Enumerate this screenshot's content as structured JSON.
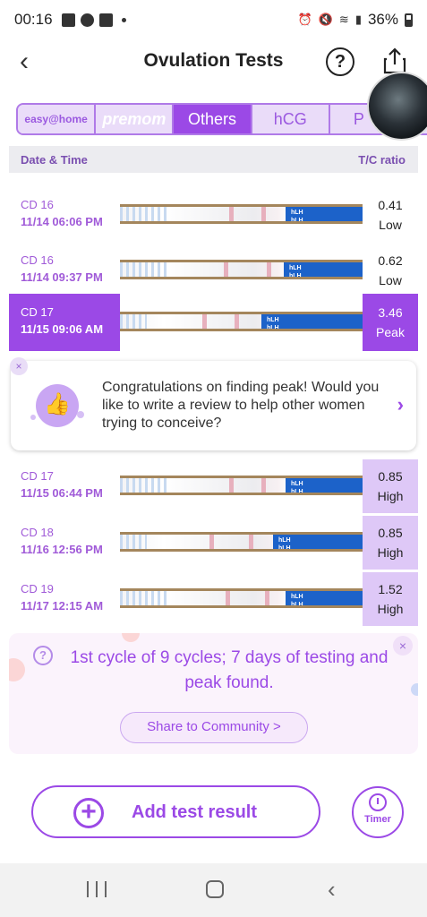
{
  "status_bar": {
    "time": "00:16",
    "battery": "36%"
  },
  "header": {
    "title": "Ovulation Tests",
    "help_symbol": "?",
    "back_symbol": "‹"
  },
  "brand_tabs": [
    {
      "label": "easy@home",
      "selected": false
    },
    {
      "label": "premom",
      "selected": false
    },
    {
      "label": "Others",
      "selected": true
    },
    {
      "label": "hCG",
      "selected": false
    },
    {
      "label": "P",
      "selected": false
    }
  ],
  "columns": {
    "date": "Date & Time",
    "ratio": "T/C ratio"
  },
  "tests": [
    {
      "cd": "CD 16",
      "datetime": "11/14  06:06 PM",
      "ratio": "0.41",
      "level": "Low"
    },
    {
      "cd": "CD 16",
      "datetime": "11/14  09:37 PM",
      "ratio": "0.62",
      "level": "Low"
    },
    {
      "cd": "CD 17",
      "datetime": "11/15  09:06 AM",
      "ratio": "3.46",
      "level": "Peak"
    },
    {
      "cd": "CD 17",
      "datetime": "11/15  06:44 PM",
      "ratio": "0.85",
      "level": "High"
    },
    {
      "cd": "CD 18",
      "datetime": "11/16  12:56 PM",
      "ratio": "0.85",
      "level": "High"
    },
    {
      "cd": "CD 19",
      "datetime": "11/17  12:15 AM",
      "ratio": "1.52",
      "level": "High"
    }
  ],
  "strip_label": "hLH",
  "review_card": {
    "message": "Congratulations on finding peak! Would you like to write a review to help other women trying to conceive?",
    "close_symbol": "×",
    "chevron": "›"
  },
  "summary": {
    "text": "1st cycle of 9 cycles; 7 days of testing and peak found.",
    "share_button": "Share to Community   >",
    "close_symbol": "×"
  },
  "actions": {
    "add_test": "Add test result",
    "timer": "Timer"
  },
  "colors": {
    "accent": "#9b49e6",
    "high_bg": "#dec8f7",
    "strip_blue": "#1c62c9"
  }
}
